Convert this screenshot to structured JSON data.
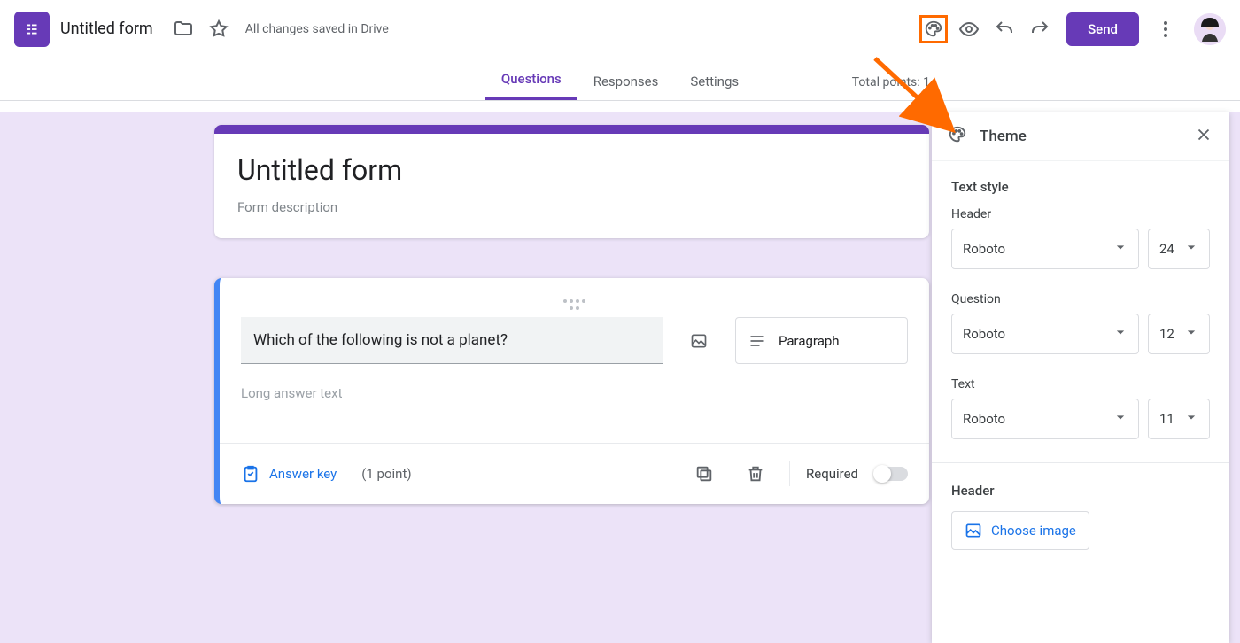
{
  "header": {
    "form_name": "Untitled form",
    "save_status": "All changes saved in Drive",
    "send_label": "Send"
  },
  "tabs": {
    "items": [
      "Questions",
      "Responses",
      "Settings"
    ],
    "active_index": 0,
    "total_points": "Total points: 1"
  },
  "form": {
    "title": "Untitled form",
    "description_placeholder": "Form description"
  },
  "question": {
    "text": "Which of the following is not a planet?",
    "type_label": "Paragraph",
    "long_answer_placeholder": "Long answer text",
    "answer_key_label": "Answer key",
    "points_label": "(1 point)",
    "required_label": "Required",
    "required": false
  },
  "theme_panel": {
    "title": "Theme",
    "text_style_title": "Text style",
    "header": {
      "label": "Header",
      "font": "Roboto",
      "size": "24"
    },
    "question": {
      "label": "Question",
      "font": "Roboto",
      "size": "12"
    },
    "text": {
      "label": "Text",
      "font": "Roboto",
      "size": "11"
    },
    "header_image_section": "Header",
    "choose_image_label": "Choose image"
  }
}
